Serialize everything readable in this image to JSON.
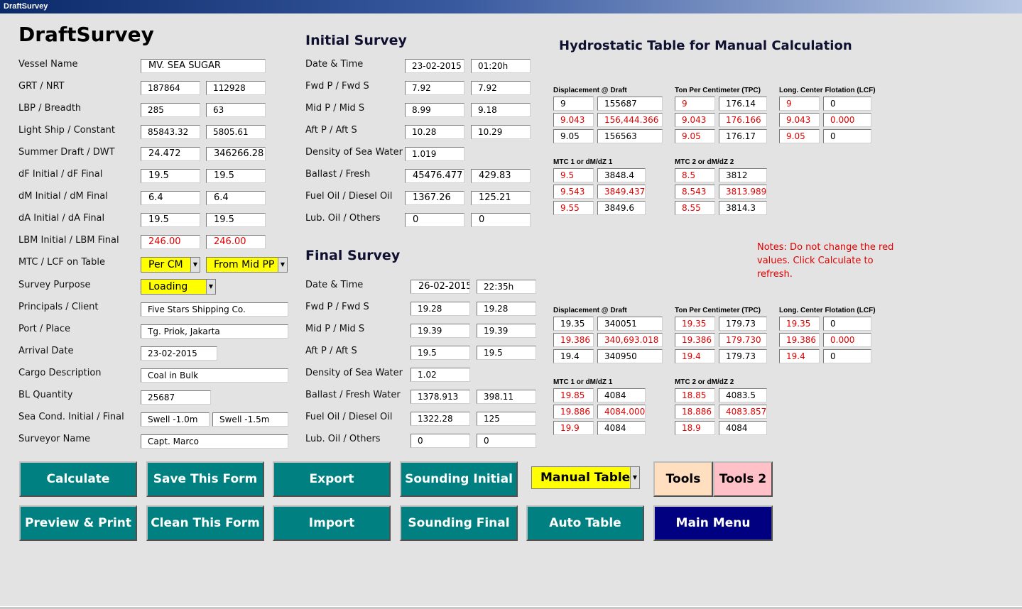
{
  "window": {
    "title": "DraftSurvey"
  },
  "app_title": "DraftSurvey",
  "vessel": {
    "labels": [
      "Vessel Name",
      "GRT / NRT",
      "LBP / Breadth",
      "Light Ship / Constant",
      "Summer Draft / DWT",
      "dF Initial / dF Final",
      "dM Initial / dM Final",
      "dA Initial / dA Final",
      "LBM Initial / LBM Final",
      "MTC / LCF on Table",
      "Survey Purpose",
      "Principals / Client",
      "Port / Place",
      "Arrival Date",
      "Cargo Description",
      "BL Quantity",
      "Sea Cond. Initial / Final",
      "Surveyor Name"
    ],
    "vessel_name": "MV. SEA SUGAR",
    "grt": "187864",
    "nrt": "112928",
    "lbp": "285",
    "breadth": "63",
    "light_ship": "85843.32",
    "constant": "5805.61",
    "summer_draft": "24.472",
    "dwt": "346266.28",
    "df_initial": "19.5",
    "df_final": "19.5",
    "dm_initial": "6.4",
    "dm_final": "6.4",
    "da_initial": "19.5",
    "da_final": "19.5",
    "lbm_initial": "246.00",
    "lbm_final": "246.00",
    "mtc_option": "Per CM",
    "lcf_option": "From Mid PP",
    "survey_purpose": "Loading",
    "principals": "Five Stars Shipping Co.",
    "port": "Tg. Priok, Jakarta",
    "arrival_date": "23-02-2015",
    "cargo": "Coal in Bulk",
    "bl_quantity": "25687",
    "sea_initial": "Swell -1.0m",
    "sea_final": "Swell -1.5m",
    "surveyor": "Capt. Marco"
  },
  "initial_survey": {
    "heading": "Initial Survey",
    "labels": [
      "Date & Time",
      "Fwd P / Fwd S",
      "Mid P / Mid S",
      "Aft P / Aft S",
      "Density of Sea Water",
      "Ballast / Fresh",
      "Fuel Oil / Diesel Oil",
      "Lub. Oil / Others"
    ],
    "date": "23-02-2015",
    "time": "01:20h",
    "fwd_p": "7.92",
    "fwd_s": "7.92",
    "mid_p": "8.99",
    "mid_s": "9.18",
    "aft_p": "10.28",
    "aft_s": "10.29",
    "density": "1.019",
    "ballast": "45476.477",
    "fresh": "429.83",
    "fuel_oil": "1367.26",
    "diesel_oil": "125.21",
    "lub_oil": "0",
    "others": "0"
  },
  "final_survey": {
    "heading": "Final Survey",
    "labels": [
      "Date & Time",
      "Fwd P / Fwd S",
      "Mid P / Mid S",
      "Aft P / Aft S",
      "Density of Sea Water",
      "Ballast / Fresh Water",
      "Fuel Oil / Diesel Oil",
      "Lub. Oil / Others"
    ],
    "date": "26-02-2015",
    "time": "22:35h",
    "fwd_p": "19.28",
    "fwd_s": "19.28",
    "mid_p": "19.39",
    "mid_s": "19.39",
    "aft_p": "19.5",
    "aft_s": "19.5",
    "density": "1.02",
    "ballast": "1378.913",
    "fresh": "398.11",
    "fuel_oil": "1322.28",
    "diesel_oil": "125",
    "lub_oil": "0",
    "others": "0"
  },
  "hydro": {
    "heading": "Hydrostatic Table for Manual Calculation",
    "notes": "Notes: Do not change the red values. Click Calculate to refresh.",
    "initial": {
      "disp_label": "Displacement @ Draft",
      "tpc_label": "Ton Per Centimeter (TPC)",
      "lcf_label": "Long. Center Flotation (LCF)",
      "mtc1_label": "MTC 1 or dM/dZ 1",
      "mtc2_label": "MTC 2 or dM/dZ 2",
      "disp": [
        [
          "9",
          "155687"
        ],
        [
          "9.043",
          "156,444.366"
        ],
        [
          "9.05",
          "156563"
        ]
      ],
      "tpc": [
        [
          "9",
          "176.14"
        ],
        [
          "9.043",
          "176.166"
        ],
        [
          "9.05",
          "176.17"
        ]
      ],
      "lcf": [
        [
          "9",
          "0"
        ],
        [
          "9.043",
          "0.000"
        ],
        [
          "9.05",
          "0"
        ]
      ],
      "mtc1": [
        [
          "9.5",
          "3848.4"
        ],
        [
          "9.543",
          "3849.437"
        ],
        [
          "9.55",
          "3849.6"
        ]
      ],
      "mtc2": [
        [
          "8.5",
          "3812"
        ],
        [
          "8.543",
          "3813.989"
        ],
        [
          "8.55",
          "3814.3"
        ]
      ]
    },
    "final": {
      "disp_label": "Displacement @ Draft",
      "tpc_label": "Ton Per Centimeter (TPC)",
      "lcf_label": "Long. Center Flotation (LCF)",
      "mtc1_label": "MTC 1 or dM/dZ 1",
      "mtc2_label": "MTC 2 or dM/dZ 2",
      "disp": [
        [
          "19.35",
          "340051"
        ],
        [
          "19.386",
          "340,693.018"
        ],
        [
          "19.4",
          "340950"
        ]
      ],
      "tpc": [
        [
          "19.35",
          "179.73"
        ],
        [
          "19.386",
          "179.730"
        ],
        [
          "19.4",
          "179.73"
        ]
      ],
      "lcf": [
        [
          "19.35",
          "0"
        ],
        [
          "19.386",
          "0.000"
        ],
        [
          "19.4",
          "0"
        ]
      ],
      "mtc1": [
        [
          "19.85",
          "4084"
        ],
        [
          "19.886",
          "4084.000"
        ],
        [
          "19.9",
          "4084"
        ]
      ],
      "mtc2": [
        [
          "18.85",
          "4083.5"
        ],
        [
          "18.886",
          "4083.857"
        ],
        [
          "18.9",
          "4084"
        ]
      ]
    }
  },
  "buttons": {
    "calculate": "Calculate",
    "save": "Save This Form",
    "export": "Export",
    "sounding_initial": "Sounding Initial",
    "table_mode": "Manual Table",
    "tools": "Tools",
    "tools2": "Tools 2",
    "preview": "Preview & Print",
    "clean": "Clean This Form",
    "import": "Import",
    "sounding_final": "Sounding Final",
    "auto_table": "Auto Table",
    "main_menu": "Main Menu"
  },
  "colors": {
    "teal": "#008080",
    "navy": "#000080",
    "yellow": "#ffff00",
    "red_value": "#e00000",
    "tools": "#ffdfc0",
    "tools2": "#ffc0c8"
  }
}
